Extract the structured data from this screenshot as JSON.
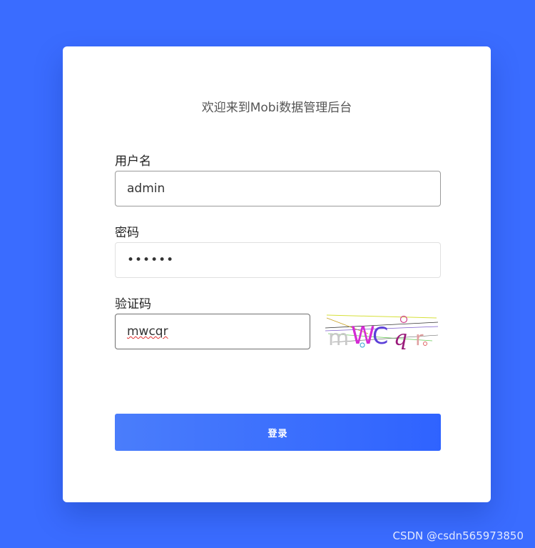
{
  "title": "欢迎来到Mobi数据管理后台",
  "form": {
    "username": {
      "label": "用户名",
      "value": "admin"
    },
    "password": {
      "label": "密码",
      "value": "••••••"
    },
    "captcha": {
      "label": "验证码",
      "value": "mwcqr",
      "image_text": "mWC q r"
    },
    "submit_label": "登录"
  },
  "watermark": "CSDN @csdn565973850",
  "colors": {
    "background": "#3a6cff",
    "button": "#3567ff"
  }
}
